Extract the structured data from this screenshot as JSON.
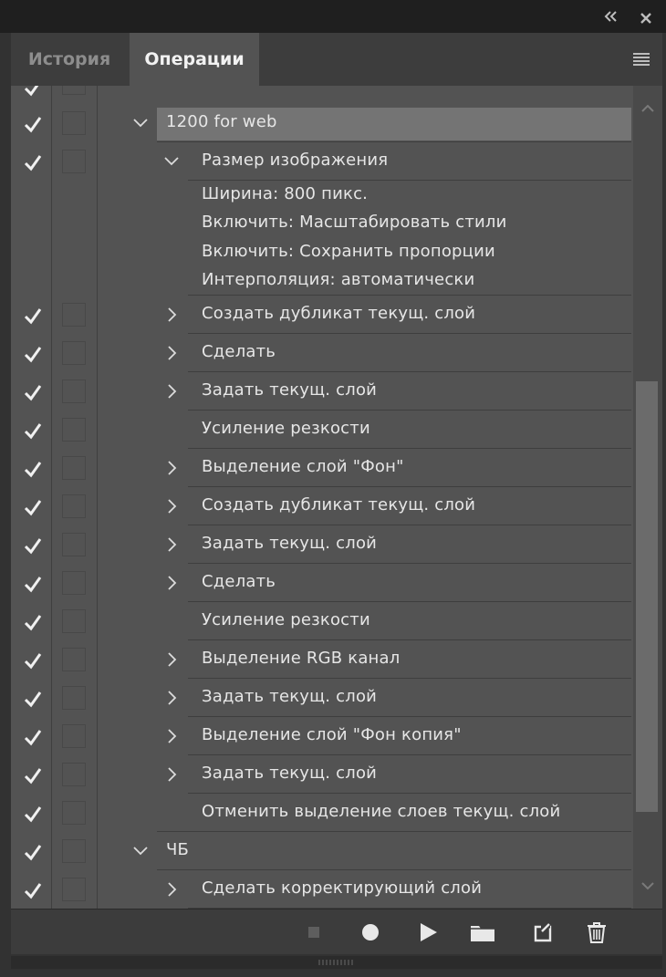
{
  "tabs": {
    "history": "История",
    "actions": "Операции"
  },
  "rows": [
    {
      "label": "1200 for web",
      "checked": true,
      "chevron": "expanded"
    },
    {
      "label": "Размер изображения",
      "checked": true,
      "chevron": "expanded"
    },
    {
      "label": "Ширина:  800 пикс."
    },
    {
      "label": "Включить: Масштабировать стили"
    },
    {
      "label": "Включить: Сохранить пропорции"
    },
    {
      "label": "Интерполяция:  автоматически"
    },
    {
      "label": "Создать дубликат текущ. слой",
      "checked": true,
      "chevron": "collapsed"
    },
    {
      "label": "Сделать",
      "checked": true,
      "chevron": "collapsed"
    },
    {
      "label": "Задать текущ. слой",
      "checked": true,
      "chevron": "collapsed"
    },
    {
      "label": "Усиление резкости",
      "checked": true
    },
    {
      "label": "Выделение слой \"Фон\"",
      "checked": true,
      "chevron": "collapsed"
    },
    {
      "label": "Создать дубликат текущ. слой",
      "checked": true,
      "chevron": "collapsed"
    },
    {
      "label": "Задать текущ. слой",
      "checked": true,
      "chevron": "collapsed"
    },
    {
      "label": "Сделать",
      "checked": true,
      "chevron": "collapsed"
    },
    {
      "label": "Усиление резкости",
      "checked": true
    },
    {
      "label": "Выделение RGB канал",
      "checked": true,
      "chevron": "collapsed"
    },
    {
      "label": "Задать текущ. слой",
      "checked": true,
      "chevron": "collapsed"
    },
    {
      "label": "Выделение слой \"Фон копия\"",
      "checked": true,
      "chevron": "collapsed"
    },
    {
      "label": "Задать текущ. слой",
      "checked": true,
      "chevron": "collapsed"
    },
    {
      "label": "Отменить выделение слоев текущ. слой",
      "checked": true
    },
    {
      "label": "ЧБ",
      "checked": true,
      "chevron": "expanded"
    },
    {
      "label": "Сделать корректирующий слой",
      "checked": true,
      "chevron": "collapsed"
    }
  ],
  "toolbar": {
    "icons": [
      "stop-icon",
      "record-icon",
      "play-icon",
      "folder-icon",
      "new-action-icon",
      "trash-icon"
    ]
  },
  "colors": {
    "panel_bg": "#535353",
    "selected_row": "#747474",
    "tab_active": "#535353",
    "text": "#e6e6e6"
  }
}
